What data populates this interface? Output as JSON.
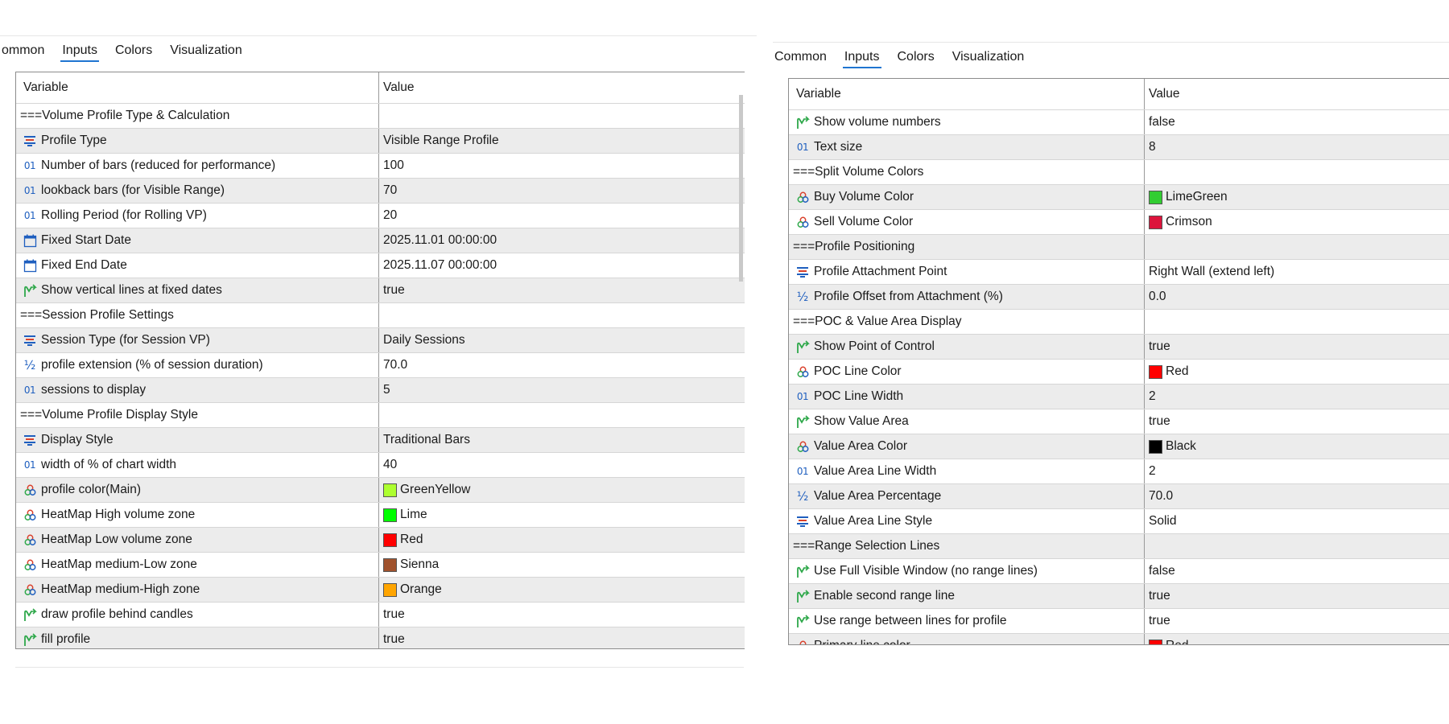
{
  "colors": {
    "accent": "#1f75d1",
    "row_shade": "#ececec",
    "border": "#8c8c8c"
  },
  "left": {
    "tabs": [
      {
        "label": "ommon",
        "active": false
      },
      {
        "label": "Inputs",
        "active": true
      },
      {
        "label": "Colors",
        "active": false
      },
      {
        "label": "Visualization",
        "active": false
      }
    ],
    "columns": {
      "variable": "Variable",
      "value": "Value"
    },
    "rows": [
      {
        "type": "section",
        "label": "===Volume Profile Type & Calculation",
        "value": ""
      },
      {
        "icon": "enum",
        "label": "Profile Type",
        "value": "Visible Range Profile"
      },
      {
        "icon": "int",
        "label": "Number of bars (reduced for performance)",
        "value": "100"
      },
      {
        "icon": "int",
        "label": "lookback bars (for Visible Range)",
        "value": "70"
      },
      {
        "icon": "int",
        "label": "Rolling Period (for Rolling VP)",
        "value": "20"
      },
      {
        "icon": "date",
        "label": "Fixed Start Date",
        "value": "2025.11.01 00:00:00"
      },
      {
        "icon": "date",
        "label": "Fixed End Date",
        "value": "2025.11.07 00:00:00"
      },
      {
        "icon": "bool",
        "label": "Show vertical lines at fixed dates",
        "value": "true"
      },
      {
        "type": "section",
        "label": "===Session Profile Settings",
        "value": ""
      },
      {
        "icon": "enum",
        "label": "Session Type (for Session VP)",
        "value": "Daily Sessions"
      },
      {
        "icon": "double",
        "label": "profile extension (% of session duration)",
        "value": "70.0"
      },
      {
        "icon": "int",
        "label": "sessions to display",
        "value": "5"
      },
      {
        "type": "section",
        "label": "===Volume Profile Display Style",
        "value": ""
      },
      {
        "icon": "enum",
        "label": "Display Style",
        "value": "Traditional Bars"
      },
      {
        "icon": "int",
        "label": "width of % of chart width",
        "value": "40"
      },
      {
        "icon": "color",
        "label": "profile color(Main)",
        "value": "GreenYellow",
        "swatch": "#adff2f"
      },
      {
        "icon": "color",
        "label": "HeatMap High volume zone",
        "value": "Lime",
        "swatch": "#00ff00"
      },
      {
        "icon": "color",
        "label": "HeatMap Low volume zone",
        "value": "Red",
        "swatch": "#ff0000"
      },
      {
        "icon": "color",
        "label": "HeatMap medium-Low zone",
        "value": "Sienna",
        "swatch": "#a0522d"
      },
      {
        "icon": "color",
        "label": "HeatMap medium-High zone",
        "value": "Orange",
        "swatch": "#ffa500"
      },
      {
        "icon": "bool",
        "label": "draw profile behind candles",
        "value": "true"
      },
      {
        "icon": "bool",
        "label": "fill profile",
        "value": "true"
      }
    ]
  },
  "right": {
    "tabs": [
      {
        "label": "Common",
        "active": false
      },
      {
        "label": "Inputs",
        "active": true
      },
      {
        "label": "Colors",
        "active": false
      },
      {
        "label": "Visualization",
        "active": false
      }
    ],
    "columns": {
      "variable": "Variable",
      "value": "Value"
    },
    "rows": [
      {
        "icon": "bool",
        "label": "Show volume numbers",
        "value": "false"
      },
      {
        "icon": "int",
        "label": "Text size",
        "value": "8"
      },
      {
        "type": "section",
        "label": "===Split Volume Colors",
        "value": ""
      },
      {
        "icon": "color",
        "label": "Buy Volume Color",
        "value": "LimeGreen",
        "swatch": "#32cd32"
      },
      {
        "icon": "color",
        "label": "Sell Volume Color",
        "value": "Crimson",
        "swatch": "#dc143c"
      },
      {
        "type": "section",
        "label": "===Profile Positioning",
        "value": ""
      },
      {
        "icon": "enum",
        "label": "Profile Attachment Point",
        "value": "Right Wall (extend left)"
      },
      {
        "icon": "double",
        "label": "Profile Offset from Attachment (%)",
        "value": "0.0"
      },
      {
        "type": "section",
        "label": "===POC & Value Area Display",
        "value": ""
      },
      {
        "icon": "bool",
        "label": "Show Point of Control",
        "value": "true"
      },
      {
        "icon": "color",
        "label": "POC Line Color",
        "value": "Red",
        "swatch": "#ff0000"
      },
      {
        "icon": "int",
        "label": "POC Line Width",
        "value": "2"
      },
      {
        "icon": "bool",
        "label": "Show Value Area",
        "value": "true"
      },
      {
        "icon": "color",
        "label": "Value Area Color",
        "value": "Black",
        "swatch": "#000000"
      },
      {
        "icon": "int",
        "label": "Value Area Line Width",
        "value": "2"
      },
      {
        "icon": "double",
        "label": "Value Area Percentage",
        "value": "70.0"
      },
      {
        "icon": "enum",
        "label": "Value Area Line Style",
        "value": "Solid"
      },
      {
        "type": "section",
        "label": "===Range Selection Lines",
        "value": ""
      },
      {
        "icon": "bool",
        "label": "Use Full Visible Window (no range lines)",
        "value": "false"
      },
      {
        "icon": "bool",
        "label": "Enable second range line",
        "value": "true"
      },
      {
        "icon": "bool",
        "label": "Use range between lines for profile",
        "value": "true"
      },
      {
        "icon": "color",
        "label": "Primary line color",
        "value": "Red",
        "swatch": "#ff0000"
      }
    ]
  }
}
